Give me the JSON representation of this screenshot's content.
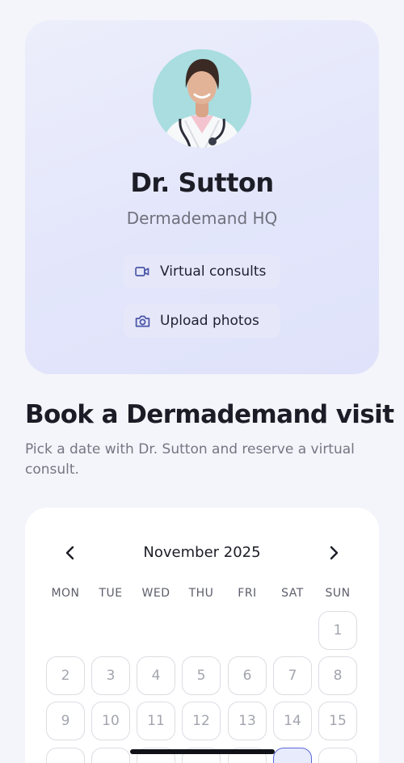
{
  "profile": {
    "name": "Dr. Sutton",
    "clinic": "Dermademand HQ",
    "chips": [
      {
        "label": "Virtual consults",
        "icon": "video-camera-icon"
      },
      {
        "label": "Upload photos",
        "icon": "camera-icon"
      }
    ]
  },
  "booking": {
    "title": "Book a Dermademand visit",
    "subtitle": "Pick a date with Dr. Sutton and reserve a virtual consult."
  },
  "calendar": {
    "month_label": "November 2025",
    "weekdays": [
      "MON",
      "TUE",
      "WED",
      "THU",
      "FRI",
      "SAT",
      "SUN"
    ],
    "days": [
      {
        "label": "1"
      },
      {
        "label": "2"
      },
      {
        "label": "3"
      },
      {
        "label": "4"
      },
      {
        "label": "5"
      },
      {
        "label": "6"
      },
      {
        "label": "7"
      },
      {
        "label": "8"
      },
      {
        "label": "9"
      },
      {
        "label": "10"
      },
      {
        "label": "11"
      },
      {
        "label": "12"
      },
      {
        "label": "13"
      },
      {
        "label": "14"
      },
      {
        "label": "15"
      },
      {
        "label": ""
      },
      {
        "label": ""
      },
      {
        "label": ""
      },
      {
        "label": ""
      },
      {
        "label": ""
      },
      {
        "label": "",
        "selected": true
      },
      {
        "label": ""
      }
    ]
  },
  "colors": {
    "accent": "#5868d8",
    "card_bg": "#e3e6fb",
    "page_bg": "#f4f5fa"
  }
}
